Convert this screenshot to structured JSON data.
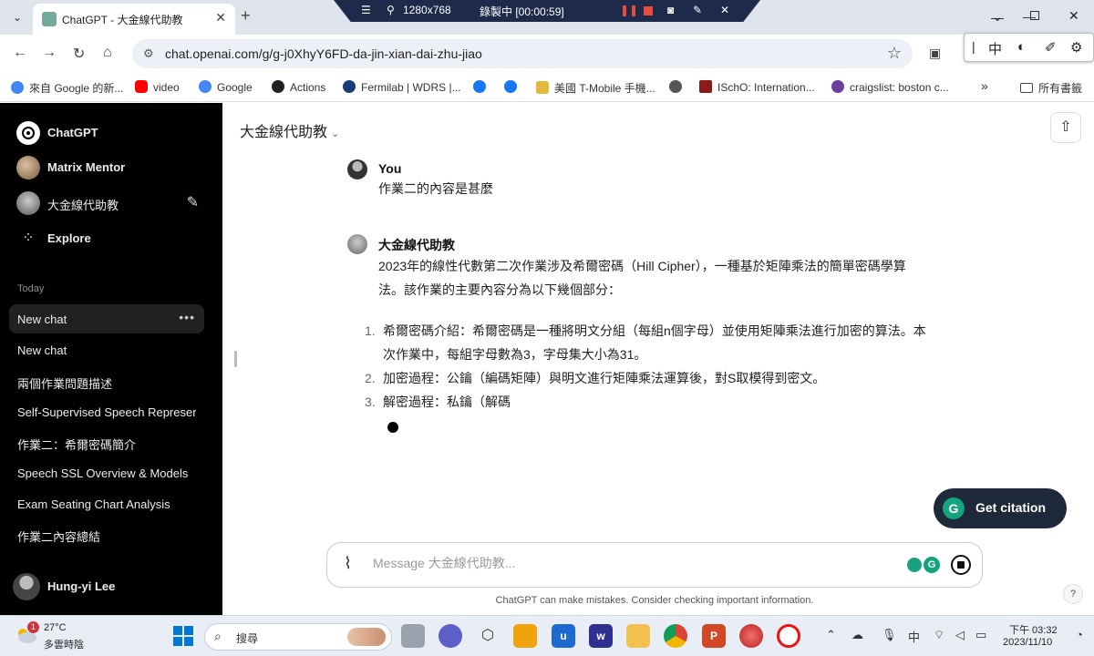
{
  "browser": {
    "tab_title": "ChatGPT - 大金線代助教",
    "url": "chat.openai.com/g/g-j0XhyY6FD-da-jin-xian-dai-zhu-jiao",
    "recording": {
      "resolution": "1280x768",
      "status": "錄製中 [00:00:59]"
    },
    "ime": {
      "mode": "中"
    },
    "bookmarks": [
      {
        "label": "來自 Google 的新...",
        "icon": "google-icon"
      },
      {
        "label": "video",
        "icon": "youtube-icon"
      },
      {
        "label": "Google",
        "icon": "google-icon"
      },
      {
        "label": "Actions",
        "icon": "github-icon"
      },
      {
        "label": "Fermilab | WDRS |...",
        "icon": "fermilab-icon"
      },
      {
        "label": "",
        "icon": "facebook-icon"
      },
      {
        "label": "",
        "icon": "facebook-icon"
      },
      {
        "label": "美國 T-Mobile 手機...",
        "icon": "tmobile-icon"
      },
      {
        "label": "",
        "icon": "globe-icon"
      },
      {
        "label": "ISchO: Internation...",
        "icon": "ischo-icon"
      },
      {
        "label": "craigslist: boston c...",
        "icon": "peace-icon"
      }
    ],
    "bookmarks_more": "»",
    "all_bookmarks": "所有書籤"
  },
  "sidebar": {
    "top": [
      {
        "label": "ChatGPT",
        "icon": "openai-logo-icon"
      },
      {
        "label": "Matrix Mentor",
        "icon": "matrix-mentor-avatar"
      },
      {
        "label": "大金線代助教",
        "icon": "gpt-avatar"
      },
      {
        "label": "Explore",
        "icon": "explore-grid-icon"
      }
    ],
    "section": "Today",
    "history": [
      "New chat",
      "New chat",
      "兩個作業問題描述",
      "Self-Supervised Speech Represen",
      "作業二：希爾密碼簡介",
      "Speech SSL Overview & Models",
      "Exam Seating Chart Analysis",
      "作業二內容總結"
    ],
    "user_name": "Hung-yi Lee"
  },
  "main": {
    "model_name": "大金線代助教",
    "user_label": "You",
    "user_message": "作業二的內容是甚麼",
    "assistant_label": "大金線代助教",
    "assistant_intro_1": "2023年的線性代數第二次作業涉及希爾密碼（Hill Cipher），一種基於矩陣乘法的簡單密碼學算",
    "assistant_intro_2": "法。該作業的主要內容分為以下幾個部分：",
    "list": [
      {
        "num": "1.",
        "line1": "希爾密碼介紹：希爾密碼是一種將明文分組（每組n個字母）並使用矩陣乘法進行加密的算法。本",
        "line2": "次作業中，每組字母數為3，字母集大小為31。"
      },
      {
        "num": "2.",
        "line1": "加密過程：公鑰（編碼矩陣）與明文進行矩陣乘法運算後，對S取模得到密文。",
        "line2": ""
      },
      {
        "num": "3.",
        "line1": "解密過程：私鑰（解碼",
        "line2": ""
      }
    ],
    "citation_button": "Get citation",
    "composer_placeholder": "Message 大金線代助教...",
    "disclaimer": "ChatGPT can make mistakes. Consider checking important information.",
    "help": "?"
  },
  "taskbar": {
    "temperature": "27°C",
    "weather": "多雲時陰",
    "weather_badge": "1",
    "search_label": "搜尋",
    "ime": "中",
    "time": "下午 03:32",
    "date": "2023/11/10"
  }
}
